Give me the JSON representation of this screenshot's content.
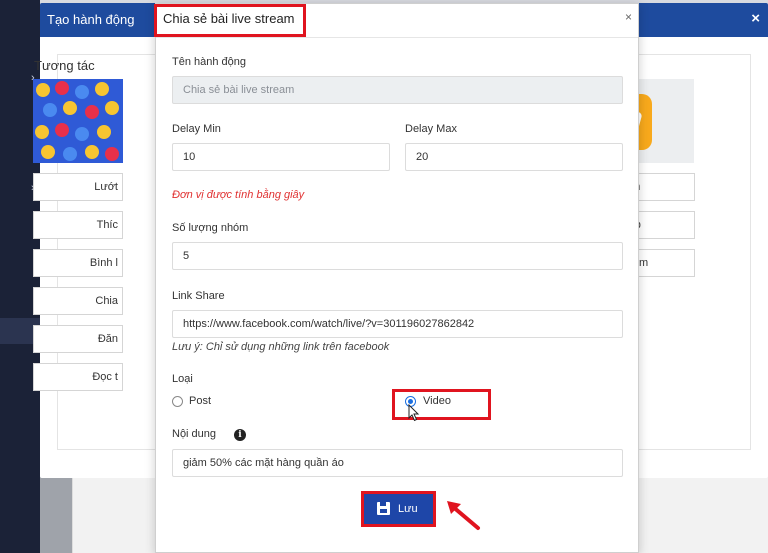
{
  "background": {
    "outer_dialog_title": "Tạo hành động",
    "outer_close": "×",
    "section_label": "Tương tác",
    "left_options": [
      "Lướt",
      "Thíc",
      "Bình l",
      "Chia",
      "Đăn",
      "Đọc t"
    ],
    "right_options": [
      "gia nhóm",
      "bài group",
      "live stream"
    ],
    "left_option_tops": [],
    "sidebar_chevrons": [
      "›",
      "›"
    ]
  },
  "modal": {
    "title": "Chia sẻ bài live stream",
    "close": "×",
    "action_name_label": "Tên hành động",
    "action_name_value": "Chia sẻ bài live stream",
    "delay_min_label": "Delay Min",
    "delay_min_value": "10",
    "delay_max_label": "Delay Max",
    "delay_max_value": "20",
    "delay_note": "Đơn vị được tính bằng giây",
    "group_count_label": "Số lượng nhóm",
    "group_count_value": "5",
    "link_share_label": "Link Share",
    "link_share_value": "https://www.facebook.com/watch/live/?v=301196027862842",
    "link_note": "Lưu ý: Chỉ sử dụng những link trên facebook",
    "type_label": "Loại",
    "type_options": [
      "Post",
      "Video"
    ],
    "type_selected": "Video",
    "content_label": "Nội dung",
    "content_value": "giảm 50% các mặt hàng quần áo",
    "save_label": "Lưu"
  },
  "colors": {
    "primary": "#1e46a8",
    "header": "#1e4b9e",
    "highlight": "#e0141f",
    "note_red": "#e03131"
  }
}
